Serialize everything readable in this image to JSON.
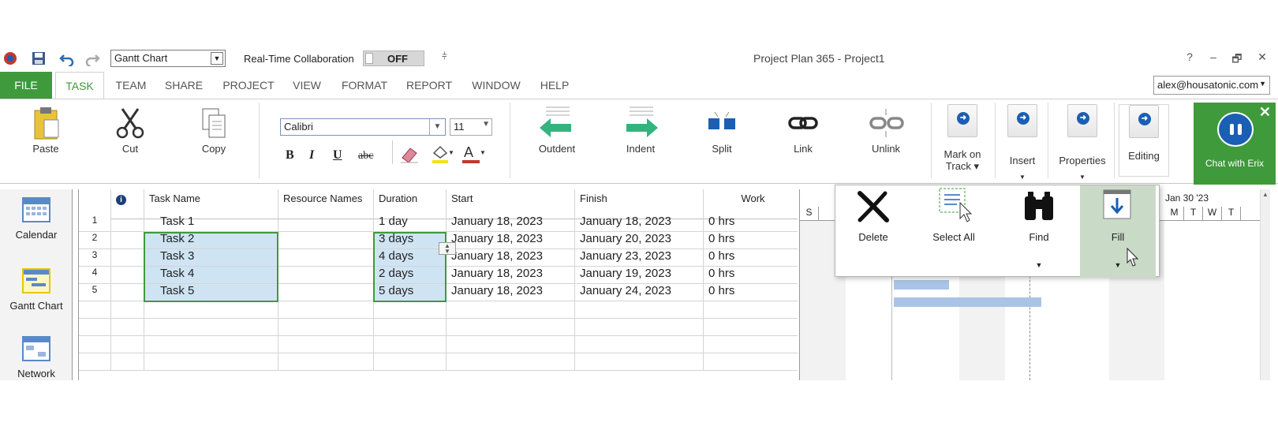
{
  "title_bar": {
    "view_selector": "Gantt Chart",
    "realtime_label": "Real-Time Collaboration",
    "realtime_state": "OFF",
    "window_title": "Project Plan 365 - Project1",
    "help": "?",
    "minimize": "–",
    "restore": "🗗",
    "close": "✕",
    "qa_more": "⫩"
  },
  "menu": {
    "items": [
      "FILE",
      "TASK",
      "TEAM",
      "SHARE",
      "PROJECT",
      "VIEW",
      "FORMAT",
      "REPORT",
      "WINDOW",
      "HELP"
    ],
    "account": "alex@housatonic.com"
  },
  "ribbon": {
    "paste": "Paste",
    "cut": "Cut",
    "copy": "Copy",
    "font": "Calibri",
    "font_size": "11",
    "bold": "B",
    "italic": "I",
    "underline": "U",
    "strike": "abc",
    "outdent": "Outdent",
    "indent": "Indent",
    "split": "Split",
    "link": "Link",
    "unlink": "Unlink",
    "mark_on_track_1": "Mark on",
    "mark_on_track_2": "Track",
    "insert": "Insert",
    "properties": "Properties",
    "editing": "Editing",
    "chat": "Chat with Erix"
  },
  "views": {
    "calendar": "Calendar",
    "gantt": "Gantt Chart",
    "network": "Network"
  },
  "grid": {
    "headers": {
      "info": "i",
      "task_name": "Task Name",
      "resource_names": "Resource Names",
      "duration": "Duration",
      "start": "Start",
      "finish": "Finish",
      "work": "Work"
    },
    "rows": [
      {
        "id": "1",
        "name": "Task 1",
        "duration": "1 day",
        "start": "January 18, 2023",
        "finish": "January 18, 2023",
        "work": "0 hrs"
      },
      {
        "id": "2",
        "name": "Task 2",
        "duration": "3 days",
        "start": "January 18, 2023",
        "finish": "January 20, 2023",
        "work": "0 hrs"
      },
      {
        "id": "3",
        "name": "Task 3",
        "duration": "4 days",
        "start": "January 18, 2023",
        "finish": "January 23, 2023",
        "work": "0 hrs"
      },
      {
        "id": "4",
        "name": "Task 4",
        "duration": "2 days",
        "start": "January 18, 2023",
        "finish": "January 19, 2023",
        "work": "0 hrs"
      },
      {
        "id": "5",
        "name": "Task 5",
        "duration": "5 days",
        "start": "January 18, 2023",
        "finish": "January 24, 2023",
        "work": "0 hrs"
      }
    ]
  },
  "gantt": {
    "week_label": "Jan 30 '23",
    "days_left": [
      "S"
    ],
    "days_right": [
      "M",
      "T",
      "W",
      "T"
    ]
  },
  "editing_panel": {
    "delete": "Delete",
    "select_all": "Select All",
    "find": "Find",
    "fill": "Fill"
  },
  "colors": {
    "brand_green": "#3f9a3b",
    "selection_blue": "#cfe4f3",
    "bar_blue": "#a9c4e6"
  }
}
